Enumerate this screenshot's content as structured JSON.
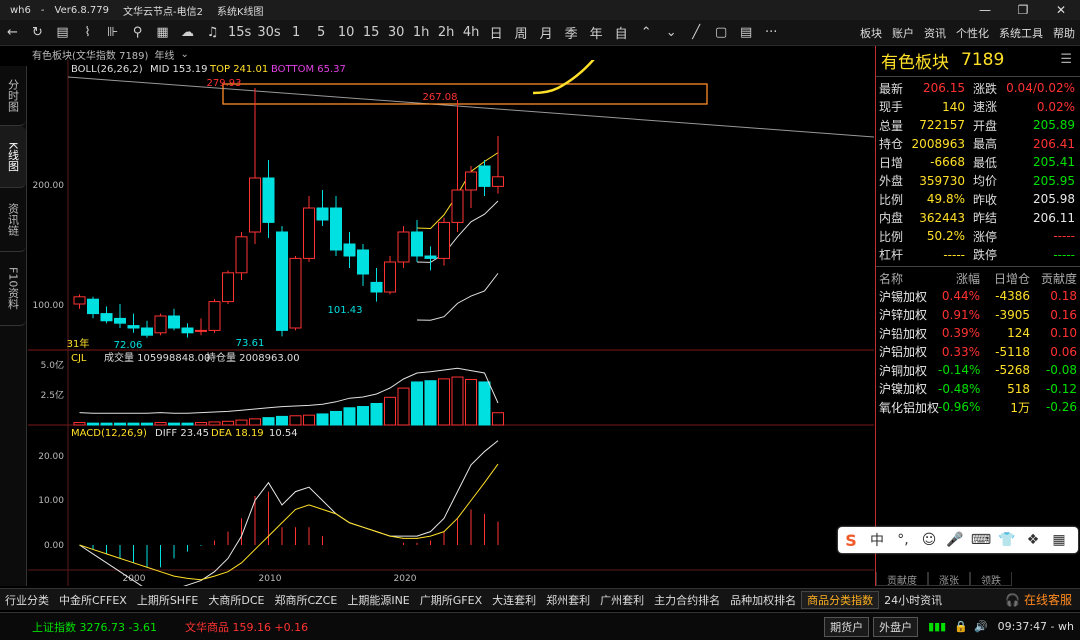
{
  "titlebar": {
    "app": "wh6",
    "version": "Ver6.8.779",
    "server": "文华云节点-电信2",
    "window": "系统K线图"
  },
  "toolbar": {
    "periods": [
      "1",
      "5",
      "10",
      "15",
      "30",
      "1h",
      "2h",
      "4h",
      "日",
      "周",
      "月",
      "季",
      "年",
      "自"
    ],
    "period_15s": "15s",
    "period_30s": "30s",
    "right_menu": [
      "板块",
      "账户",
      "资讯",
      "个性化",
      "系统工具",
      "帮助"
    ]
  },
  "left_tabs": [
    {
      "label": "分时图"
    },
    {
      "label": "K线图"
    },
    {
      "label": "资讯链"
    },
    {
      "label": "F10资料"
    }
  ],
  "chart_header": {
    "name": "有色板块(文华指数 7189)",
    "period": "年线"
  },
  "boll": {
    "label": "BOLL(26,26,2)",
    "mid": "MID 153.19",
    "top": "TOP 241.01",
    "bottom": "BOTTOM 65.37"
  },
  "cjl": {
    "label": "CJL",
    "volume": "成交量 105998848.00",
    "oi": "持仓量 2008963.00"
  },
  "macd": {
    "label": "MACD(12,26,9)",
    "diff": "DIFF 23.45",
    "dea": "DEA 18.19",
    "value": "10.54"
  },
  "annotations": {
    "high": "279.93",
    "box_high": "267.08",
    "low1": "72.06",
    "low2": "73.61",
    "low3": "101.43",
    "start": "31年"
  },
  "chart_data": {
    "type": "candlestick",
    "price_axis": {
      "ticks": [
        100.0,
        200.0
      ],
      "labels": [
        "100.00",
        "200.00"
      ]
    },
    "volume_axis": {
      "labels": [
        "2.5亿",
        "5.0亿"
      ]
    },
    "macd_axis": {
      "labels": [
        "0.00",
        "10.00",
        "20.00"
      ]
    },
    "x_labels": [
      "2000",
      "2010",
      "2020"
    ],
    "candles": [
      {
        "o": 100,
        "h": 108,
        "l": 96,
        "c": 106
      },
      {
        "o": 104,
        "h": 106,
        "l": 88,
        "c": 92
      },
      {
        "o": 92,
        "h": 98,
        "l": 84,
        "c": 86
      },
      {
        "o": 88,
        "h": 100,
        "l": 80,
        "c": 84
      },
      {
        "o": 82,
        "h": 92,
        "l": 76,
        "c": 80
      },
      {
        "o": 80,
        "h": 86,
        "l": 72,
        "c": 74
      },
      {
        "o": 76,
        "h": 92,
        "l": 74,
        "c": 90
      },
      {
        "o": 90,
        "h": 96,
        "l": 78,
        "c": 80
      },
      {
        "o": 80,
        "h": 84,
        "l": 72,
        "c": 76
      },
      {
        "o": 78,
        "h": 88,
        "l": 74,
        "c": 78
      },
      {
        "o": 78,
        "h": 104,
        "l": 76,
        "c": 102
      },
      {
        "o": 102,
        "h": 128,
        "l": 100,
        "c": 126
      },
      {
        "o": 126,
        "h": 160,
        "l": 120,
        "c": 156
      },
      {
        "o": 160,
        "h": 280,
        "l": 150,
        "c": 205
      },
      {
        "o": 205,
        "h": 220,
        "l": 155,
        "c": 168
      },
      {
        "o": 160,
        "h": 165,
        "l": 73,
        "c": 78
      },
      {
        "o": 80,
        "h": 140,
        "l": 78,
        "c": 138
      },
      {
        "o": 138,
        "h": 190,
        "l": 135,
        "c": 180
      },
      {
        "o": 180,
        "h": 195,
        "l": 165,
        "c": 170
      },
      {
        "o": 180,
        "h": 190,
        "l": 140,
        "c": 145
      },
      {
        "o": 150,
        "h": 160,
        "l": 130,
        "c": 140
      },
      {
        "o": 145,
        "h": 150,
        "l": 115,
        "c": 125
      },
      {
        "o": 118,
        "h": 130,
        "l": 102,
        "c": 110
      },
      {
        "o": 110,
        "h": 140,
        "l": 108,
        "c": 135
      },
      {
        "o": 135,
        "h": 165,
        "l": 130,
        "c": 160
      },
      {
        "o": 160,
        "h": 170,
        "l": 135,
        "c": 140
      },
      {
        "o": 140,
        "h": 148,
        "l": 128,
        "c": 138
      },
      {
        "o": 138,
        "h": 172,
        "l": 132,
        "c": 168
      },
      {
        "o": 168,
        "h": 270,
        "l": 160,
        "c": 195
      },
      {
        "o": 195,
        "h": 215,
        "l": 180,
        "c": 210
      },
      {
        "o": 215,
        "h": 220,
        "l": 190,
        "c": 198
      },
      {
        "o": 198,
        "h": 240,
        "l": 192,
        "c": 206
      }
    ],
    "volume": [
      4,
      3,
      3,
      3,
      3,
      3,
      4,
      3,
      3,
      4,
      5,
      6,
      8,
      10,
      12,
      14,
      15,
      16,
      18,
      22,
      28,
      30,
      35,
      45,
      60,
      70,
      72,
      75,
      78,
      74,
      70,
      20
    ],
    "macd_diff": [
      0,
      -2,
      -4,
      -6,
      -8,
      -10,
      -11,
      -10,
      -9,
      -8,
      -6,
      -3,
      2,
      10,
      14,
      9,
      12,
      13,
      10,
      7,
      5,
      4,
      3,
      2,
      2,
      2,
      3,
      6,
      12,
      18,
      21,
      23.45
    ],
    "macd_dea": [
      0,
      -1,
      -2,
      -3,
      -4,
      -5,
      -6,
      -7,
      -7.5,
      -7.8,
      -7,
      -6,
      -4,
      -1,
      2,
      5,
      8,
      9,
      8,
      7,
      5,
      4,
      3,
      2,
      1.5,
      1.5,
      2,
      3,
      6,
      10,
      14,
      18.19
    ],
    "macd_hist": [
      0,
      -1,
      -2,
      -3,
      -4,
      -5,
      -5,
      -3,
      -1.5,
      -0.2,
      1,
      3,
      6,
      11,
      12,
      4,
      4,
      4,
      2,
      0,
      0,
      0,
      0,
      0,
      0.5,
      0.5,
      1,
      3,
      6,
      8,
      7,
      5.26
    ]
  },
  "quote": {
    "name": "有色板块",
    "code": "7189",
    "rows": [
      {
        "l1": "最新",
        "v1": "206.15",
        "c1": "red",
        "l2": "涨跌",
        "v2": "0.04/0.02%",
        "c2": "red"
      },
      {
        "l1": "现手",
        "v1": "140",
        "c1": "yellow",
        "l2": "速涨",
        "v2": "0.02%",
        "c2": "red"
      },
      {
        "l1": "总量",
        "v1": "722157",
        "c1": "yellow",
        "l2": "开盘",
        "v2": "205.89",
        "c2": "green"
      },
      {
        "l1": "持仓",
        "v1": "2008963",
        "c1": "yellow",
        "l2": "最高",
        "v2": "206.41",
        "c2": "red"
      },
      {
        "l1": "日增",
        "v1": "-6668",
        "c1": "yellow",
        "l2": "最低",
        "v2": "205.41",
        "c2": "green"
      },
      {
        "l1": "外盘",
        "v1": "359730",
        "c1": "yellow",
        "l2": "均价",
        "v2": "205.95",
        "c2": "green"
      },
      {
        "l1": "比例",
        "v1": "49.8%",
        "c1": "yellow",
        "l2": "昨收",
        "v2": "205.98",
        "c2": "white"
      },
      {
        "l1": "内盘",
        "v1": "362443",
        "c1": "yellow",
        "l2": "昨结",
        "v2": "206.11",
        "c2": "white"
      },
      {
        "l1": "比例",
        "v1": "50.2%",
        "c1": "yellow",
        "l2": "涨停",
        "v2": "-----",
        "c2": "red"
      },
      {
        "l1": "杠杆",
        "v1": "-----",
        "c1": "yellow",
        "l2": "跌停",
        "v2": "-----",
        "c2": "green"
      }
    ]
  },
  "sector": {
    "headers": [
      "名称",
      "涨幅",
      "日增仓",
      "贡献度"
    ],
    "rows": [
      {
        "n": "沪锡加权",
        "a": "0.44%",
        "ac": "red",
        "b": "-4386",
        "c": "0.18",
        "cc": "red"
      },
      {
        "n": "沪锌加权",
        "a": "0.91%",
        "ac": "red",
        "b": "-3905",
        "c": "0.16",
        "cc": "red"
      },
      {
        "n": "沪铅加权",
        "a": "0.39%",
        "ac": "red",
        "b": "124",
        "c": "0.10",
        "cc": "red"
      },
      {
        "n": "沪铝加权",
        "a": "0.33%",
        "ac": "red",
        "b": "-5118",
        "c": "0.06",
        "cc": "red"
      },
      {
        "n": "沪铜加权",
        "a": "-0.14%",
        "ac": "green",
        "b": "-5268",
        "c": "-0.08",
        "cc": "green"
      },
      {
        "n": "沪镍加权",
        "a": "-0.48%",
        "ac": "green",
        "b": "518",
        "c": "-0.12",
        "cc": "green"
      },
      {
        "n": "氧化铝加权",
        "a": "-0.96%",
        "ac": "green",
        "b": "1万",
        "c": "-0.26",
        "cc": "green"
      }
    ],
    "bottom_tabs": [
      "贡献度",
      "涨张",
      "领跌"
    ]
  },
  "bottom_tabs": [
    "行业分类",
    "中金所CFFEX",
    "上期所SHFE",
    "大商所DCE",
    "郑商所CZCE",
    "上期能源INE",
    "广期所GFEX",
    "大连套利",
    "郑州套利",
    "广州套利",
    "主力合约排名",
    "品种加权排名",
    "商品分类指数",
    "24小时资讯"
  ],
  "active_bottom_tab": 12,
  "kefu": "在线客服",
  "status": {
    "sh": "上证指数  3276.73  -3.61",
    "wh": "文华商品  159.16  +0.16",
    "btn1": "期货户",
    "btn2": "外盘户",
    "clock": "09:37:47 - wh"
  },
  "ime": {
    "logo": "S",
    "items": [
      "中",
      "°,",
      "☺",
      "🎤",
      "⌨",
      "👕",
      "❖",
      "▦"
    ]
  }
}
